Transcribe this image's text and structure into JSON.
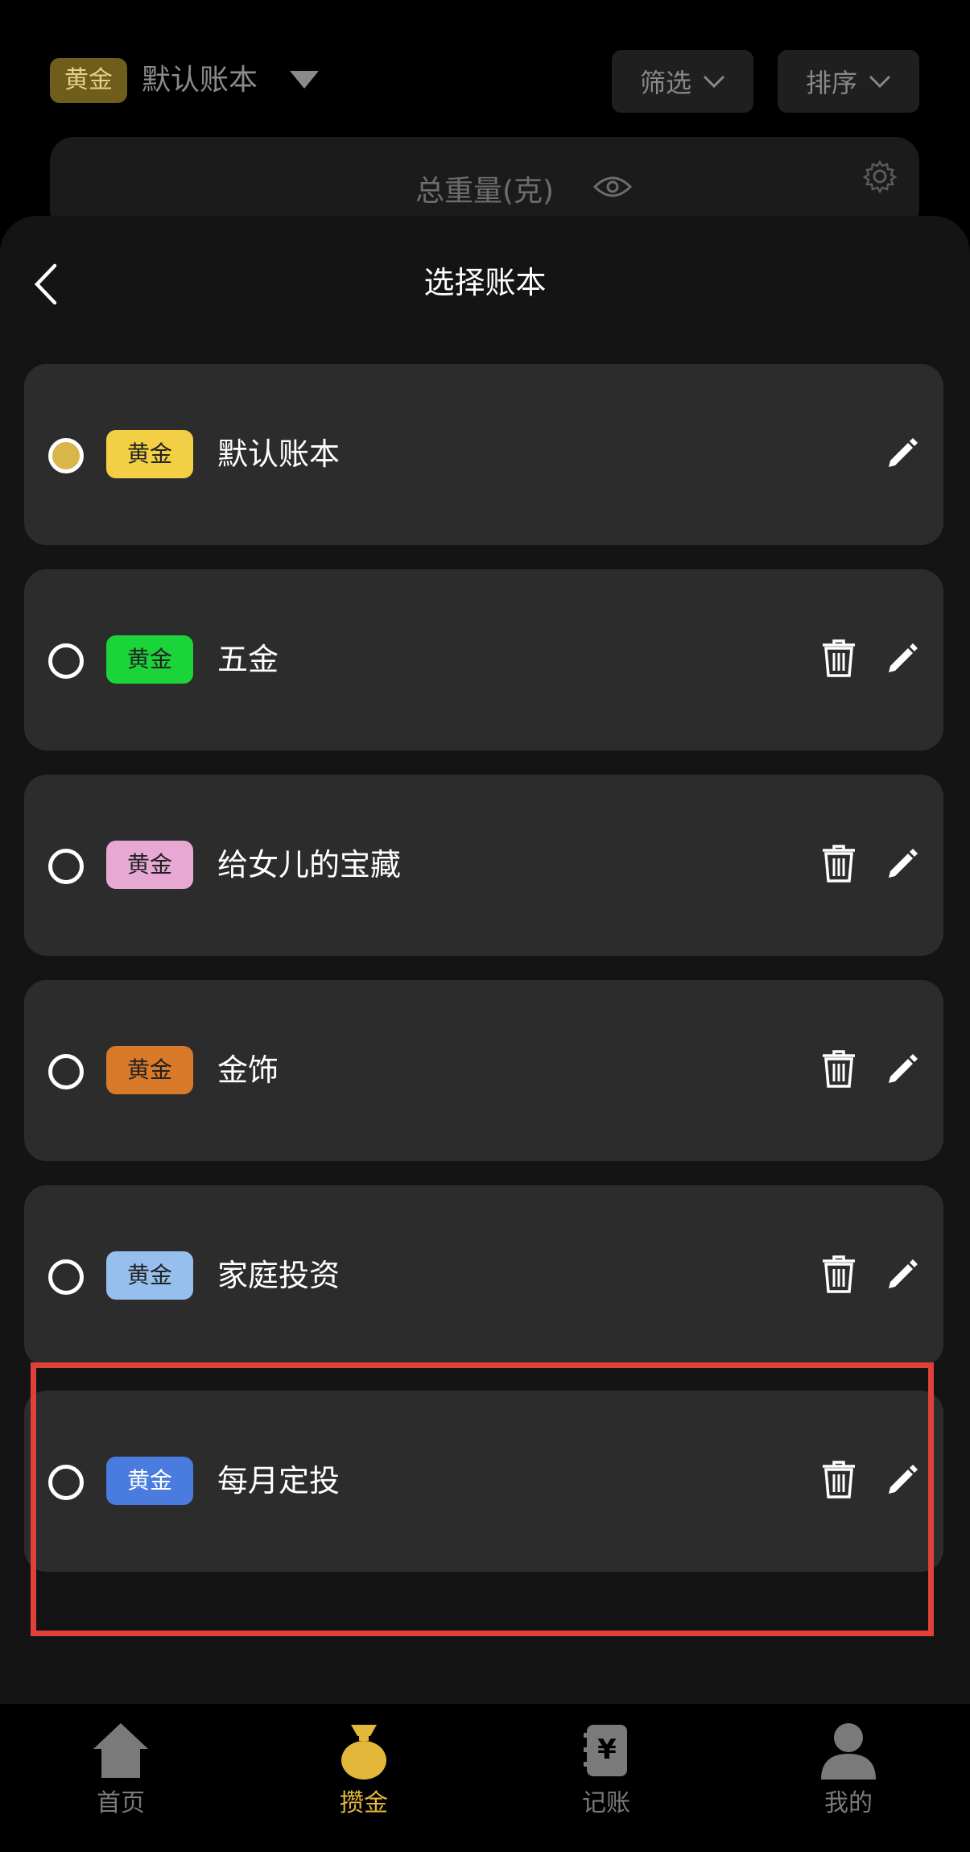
{
  "header": {
    "tag": "黄金",
    "book_name": "默认账本",
    "filter_label": "筛选",
    "sort_label": "排序"
  },
  "summary": {
    "title": "总重量(克)"
  },
  "sheet": {
    "title": "选择账本",
    "books": [
      {
        "tag": "黄金",
        "name": "默认账本",
        "tag_color": "#f2cf44",
        "selected": true,
        "deletable": false
      },
      {
        "tag": "黄金",
        "name": "五金",
        "tag_color": "#1ad43a",
        "selected": false,
        "deletable": true
      },
      {
        "tag": "黄金",
        "name": "给女儿的宝藏",
        "tag_color": "#e7a9d4",
        "selected": false,
        "deletable": true
      },
      {
        "tag": "黄金",
        "name": "金饰",
        "tag_color": "#d97a2a",
        "selected": false,
        "deletable": true
      },
      {
        "tag": "黄金",
        "name": "家庭投资",
        "tag_color": "#97bfee",
        "selected": false,
        "deletable": true
      },
      {
        "tag": "黄金",
        "name": "每月定投",
        "tag_color": "#4a7ce0",
        "selected": false,
        "deletable": true
      }
    ]
  },
  "nav": {
    "items": [
      {
        "label": "首页",
        "icon": "home-icon",
        "active": false
      },
      {
        "label": "攒金",
        "icon": "money-bag-icon",
        "active": true
      },
      {
        "label": "记账",
        "icon": "ledger-icon",
        "active": false
      },
      {
        "label": "我的",
        "icon": "user-icon",
        "active": false
      }
    ]
  },
  "colors": {
    "accent_gold": "#e2b73a",
    "highlight_red": "#e0403a",
    "row_bg": "#2c2c2c"
  }
}
